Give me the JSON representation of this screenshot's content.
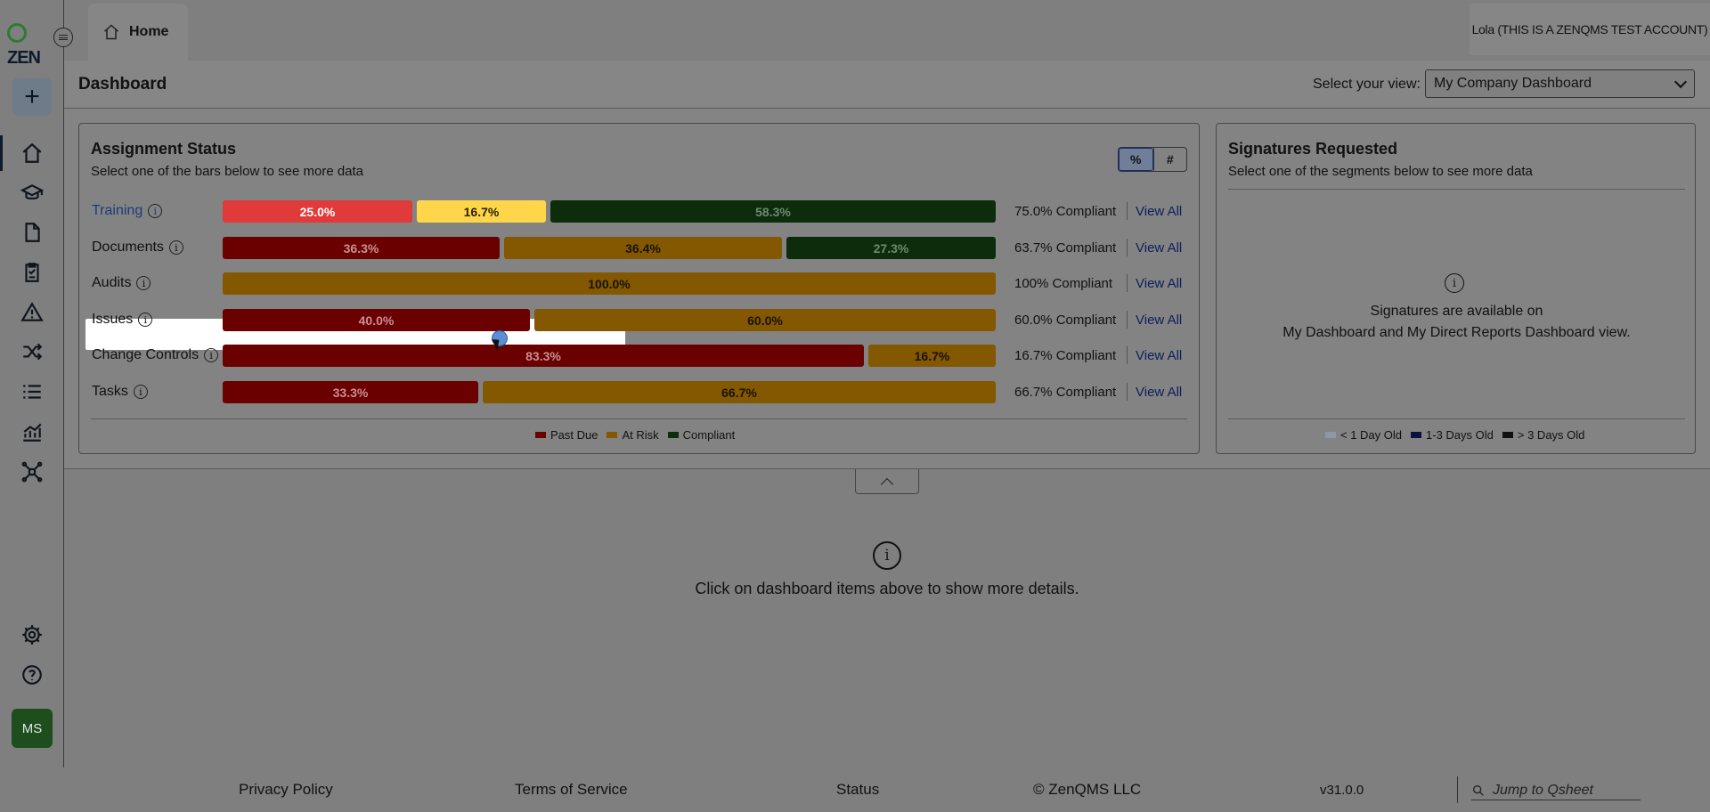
{
  "app": {
    "logo_text": "ZEN"
  },
  "tabs": [
    {
      "label": "Home"
    }
  ],
  "account": {
    "name": "Lola (THIS IS A ZENQMS TEST ACCOUNT)",
    "initials": "MS"
  },
  "header": {
    "title": "Dashboard",
    "view_label": "Select your view:",
    "view_value": "My Company Dashboard"
  },
  "assignment": {
    "title": "Assignment Status",
    "subtitle": "Select one of the bars below to see more data",
    "toggle": {
      "percent": "%",
      "count": "#",
      "selected": "percent"
    },
    "rows": [
      {
        "label": "Training",
        "segments": {
          "past_due": "25.0%",
          "at_risk": "16.7%",
          "compliant": "58.3%"
        },
        "compliance": "75.0% Compliant",
        "link": "View All"
      },
      {
        "label": "Documents",
        "segments": {
          "past_due": "36.3%",
          "at_risk": "36.4%",
          "compliant": "27.3%"
        },
        "compliance": "63.7% Compliant",
        "link": "View All"
      },
      {
        "label": "Audits",
        "segments": {
          "past_due": "",
          "at_risk": "100.0%",
          "compliant": ""
        },
        "compliance": "100% Compliant",
        "link": "View All"
      },
      {
        "label": "Issues",
        "segments": {
          "past_due": "40.0%",
          "at_risk": "60.0%",
          "compliant": ""
        },
        "compliance": "60.0% Compliant",
        "link": "View All"
      },
      {
        "label": "Change Controls",
        "segments": {
          "past_due": "83.3%",
          "at_risk": "16.7%",
          "compliant": ""
        },
        "compliance": "16.7% Compliant",
        "link": "View All"
      },
      {
        "label": "Tasks",
        "segments": {
          "past_due": "33.3%",
          "at_risk": "66.7%",
          "compliant": ""
        },
        "compliance": "66.7% Compliant",
        "link": "View All"
      }
    ],
    "legend": [
      "Past Due",
      "At Risk",
      "Compliant"
    ],
    "colors": {
      "past_due": "#6b0000",
      "at_risk": "#835800",
      "compliant": "#0c2c0c",
      "highlight_past_due": "#e03a3a",
      "highlight_at_risk": "#ffd54a"
    }
  },
  "signatures": {
    "title": "Signatures Requested",
    "subtitle": "Select one of the segments below to see more data",
    "message_line1": "Signatures are available on",
    "message_line2": "My Dashboard and My Direct Reports Dashboard view.",
    "legend": [
      "< 1 Day Old",
      "1-3 Days Old",
      "> 3 Days Old"
    ],
    "legend_colors": [
      "#8e96a8",
      "#0a1240",
      "#111111"
    ]
  },
  "details": {
    "message": "Click on dashboard items above to show more details."
  },
  "footer": {
    "privacy": "Privacy Policy",
    "terms": "Terms of Service",
    "status": "Status",
    "copyright": "© ZenQMS LLC",
    "version": "v31.0.0",
    "jump_placeholder": "Jump to Qsheet"
  },
  "icons": [
    "home-icon",
    "training-icon",
    "documents-icon",
    "audits-icon",
    "issues-icon",
    "change-controls-icon",
    "tasks-icon",
    "reports-icon",
    "network-icon",
    "settings-icon",
    "help-icon"
  ]
}
